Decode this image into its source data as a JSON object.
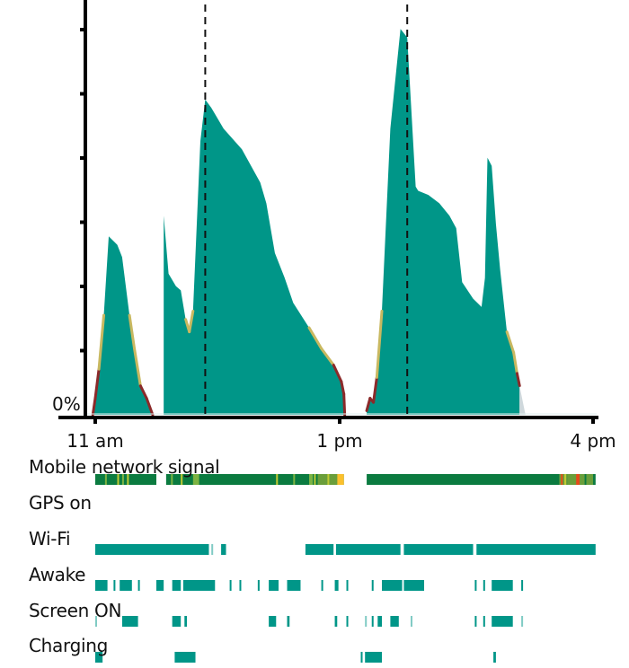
{
  "chart_data": {
    "type": "area",
    "title": "",
    "xlabel": "",
    "ylabel": "",
    "y_tick_label": "0%",
    "x_ticks": [
      {
        "label": "11 am",
        "hour": 11
      },
      {
        "label": "1 pm",
        "hour": 13
      },
      {
        "label": "4 pm",
        "hour": 16
      }
    ],
    "x_range_hours": [
      10.95,
      16.03
    ],
    "ylim": [
      0,
      100
    ],
    "y_ticks_count": 7,
    "markers_hours": [
      11.9,
      13.8
    ],
    "fill_color": "#009688",
    "low_line_color": "#c8b860",
    "critical_line_color": "#8b2a2a",
    "projection_color": "#cfd8dc",
    "series": [
      {
        "name": "battery-segment-1",
        "points": [
          [
            10.98,
            0
          ],
          [
            11.0,
            4
          ],
          [
            11.03,
            11
          ],
          [
            11.07,
            24
          ],
          [
            11.11,
            43
          ],
          [
            11.18,
            41
          ],
          [
            11.22,
            38
          ],
          [
            11.28,
            24
          ],
          [
            11.32,
            16
          ],
          [
            11.37,
            7
          ],
          [
            11.42,
            4
          ],
          [
            11.47,
            0
          ]
        ]
      },
      {
        "name": "battery-segment-2",
        "points": [
          [
            11.56,
            48
          ],
          [
            11.6,
            34
          ],
          [
            11.66,
            31
          ],
          [
            11.7,
            30
          ],
          [
            11.74,
            23
          ],
          [
            11.77,
            20
          ],
          [
            11.8,
            25
          ],
          [
            11.86,
            66
          ],
          [
            11.9,
            76
          ],
          [
            11.95,
            74
          ],
          [
            12.05,
            69
          ],
          [
            12.2,
            64
          ],
          [
            12.35,
            56
          ],
          [
            12.4,
            51
          ],
          [
            12.47,
            39
          ],
          [
            12.55,
            33
          ],
          [
            12.62,
            27
          ],
          [
            12.75,
            21
          ],
          [
            12.85,
            16
          ],
          [
            12.95,
            12
          ],
          [
            13.02,
            8
          ],
          [
            13.05,
            5
          ],
          [
            13.06,
            0
          ]
        ]
      },
      {
        "name": "battery-segment-3",
        "points": [
          [
            13.32,
            1
          ],
          [
            13.36,
            4
          ],
          [
            13.4,
            3
          ],
          [
            13.44,
            9
          ],
          [
            13.5,
            25
          ],
          [
            13.6,
            69
          ],
          [
            13.72,
            93
          ],
          [
            13.8,
            91
          ],
          [
            13.9,
            55
          ],
          [
            13.93,
            54
          ],
          [
            14.05,
            53
          ],
          [
            14.18,
            51
          ],
          [
            14.3,
            48
          ],
          [
            14.38,
            45
          ],
          [
            14.45,
            32
          ],
          [
            14.58,
            28
          ],
          [
            14.68,
            26
          ],
          [
            14.72,
            33
          ],
          [
            14.75,
            62
          ],
          [
            14.8,
            60
          ],
          [
            14.85,
            46
          ],
          [
            14.9,
            35
          ],
          [
            14.98,
            20
          ],
          [
            15.06,
            15
          ],
          [
            15.1,
            10
          ],
          [
            15.13,
            7
          ]
        ]
      },
      {
        "name": "battery-projection",
        "points": [
          [
            15.13,
            7
          ],
          [
            15.2,
            0
          ]
        ]
      }
    ]
  },
  "rows": [
    {
      "label": "Mobile network signal",
      "key": "signal"
    },
    {
      "label": "GPS on",
      "key": "gps"
    },
    {
      "label": "Wi-Fi",
      "key": "wifi"
    },
    {
      "label": "Awake",
      "key": "awake"
    },
    {
      "label": "Screen ON",
      "key": "screen"
    },
    {
      "label": "Charging",
      "key": "charging"
    }
  ],
  "bars": {
    "signal": [
      [
        11.0,
        11.5,
        "#0b7b40"
      ],
      [
        11.08,
        11.09,
        "#7cb342"
      ],
      [
        11.18,
        11.19,
        "#c0ca33"
      ],
      [
        11.22,
        11.23,
        "#7cb342"
      ],
      [
        11.26,
        11.27,
        "#c0ca33"
      ],
      [
        11.58,
        13.05,
        "#0b7b40"
      ],
      [
        11.62,
        11.63,
        "#7cb342"
      ],
      [
        11.7,
        11.71,
        "#c0ca33"
      ],
      [
        11.8,
        11.85,
        "#7cb342"
      ],
      [
        12.48,
        12.49,
        "#c0ca33"
      ],
      [
        12.62,
        12.63,
        "#7cb342"
      ],
      [
        12.75,
        12.78,
        "#7cb342"
      ],
      [
        12.79,
        12.8,
        "#c0ca33"
      ],
      [
        12.82,
        12.98,
        "#6a9e3a"
      ],
      [
        12.9,
        12.91,
        "#c0ca33"
      ],
      [
        12.98,
        13.05,
        "#fbc02d"
      ],
      [
        13.32,
        16.03,
        "#0b7b40"
      ],
      [
        15.6,
        15.7,
        "#6a9e3a"
      ],
      [
        15.62,
        15.63,
        "#e64a19"
      ],
      [
        15.66,
        15.67,
        "#c0ca33"
      ],
      [
        15.7,
        15.9,
        "#6a9e3a"
      ],
      [
        15.8,
        15.84,
        "#e64a19"
      ],
      [
        15.92,
        16.0,
        "#6a9e3a"
      ]
    ],
    "gps": [],
    "wifi": [
      [
        11.0,
        11.93,
        "#009688"
      ],
      [
        11.95,
        11.96,
        "#80cbc4"
      ],
      [
        12.03,
        12.07,
        "#009688"
      ],
      [
        12.72,
        12.95,
        "#009688"
      ],
      [
        12.97,
        13.72,
        "#009688"
      ],
      [
        13.76,
        14.58,
        "#009688"
      ],
      [
        14.62,
        16.03,
        "#009688"
      ]
    ],
    "awake": [
      [
        11.0,
        11.1,
        "#009688"
      ],
      [
        11.15,
        11.16,
        "#009688"
      ],
      [
        11.2,
        11.3,
        "#009688"
      ],
      [
        11.35,
        11.36,
        "#009688"
      ],
      [
        11.5,
        11.56,
        "#009688"
      ],
      [
        11.63,
        11.7,
        "#009688"
      ],
      [
        11.72,
        11.98,
        "#009688"
      ],
      [
        12.1,
        12.11,
        "#009688"
      ],
      [
        12.18,
        12.19,
        "#009688"
      ],
      [
        12.33,
        12.34,
        "#009688"
      ],
      [
        12.42,
        12.5,
        "#009688"
      ],
      [
        12.57,
        12.68,
        "#009688"
      ],
      [
        12.85,
        12.86,
        "#009688"
      ],
      [
        12.96,
        12.99,
        "#009688"
      ],
      [
        13.08,
        13.09,
        "#009688"
      ],
      [
        13.38,
        13.39,
        "#009688"
      ],
      [
        13.5,
        13.74,
        "#009688"
      ],
      [
        13.76,
        14.0,
        "#009688"
      ],
      [
        14.6,
        14.62,
        "#009688"
      ],
      [
        14.7,
        14.72,
        "#009688"
      ],
      [
        14.8,
        15.05,
        "#009688"
      ],
      [
        15.15,
        15.16,
        "#009688"
      ]
    ],
    "screen": [
      [
        11.0,
        11.01,
        "#80cbc4"
      ],
      [
        11.22,
        11.35,
        "#009688"
      ],
      [
        11.63,
        11.7,
        "#009688"
      ],
      [
        11.73,
        11.75,
        "#009688"
      ],
      [
        12.42,
        12.48,
        "#009688"
      ],
      [
        12.57,
        12.59,
        "#009688"
      ],
      [
        12.96,
        12.98,
        "#009688"
      ],
      [
        13.08,
        13.09,
        "#009688"
      ],
      [
        13.3,
        13.31,
        "#80cbc4"
      ],
      [
        13.38,
        13.39,
        "#009688"
      ],
      [
        13.45,
        13.5,
        "#009688"
      ],
      [
        13.6,
        13.7,
        "#009688"
      ],
      [
        13.84,
        13.85,
        "#80cbc4"
      ],
      [
        14.6,
        14.62,
        "#009688"
      ],
      [
        14.7,
        14.71,
        "#009688"
      ],
      [
        14.8,
        15.05,
        "#009688"
      ],
      [
        15.15,
        15.16,
        "#80cbc4"
      ]
    ],
    "charging": [
      [
        11.0,
        11.06,
        "#009688"
      ],
      [
        11.65,
        11.82,
        "#009688"
      ],
      [
        13.25,
        13.26,
        "#009688"
      ],
      [
        13.3,
        13.5,
        "#009688"
      ],
      [
        14.82,
        14.85,
        "#009688"
      ]
    ]
  }
}
